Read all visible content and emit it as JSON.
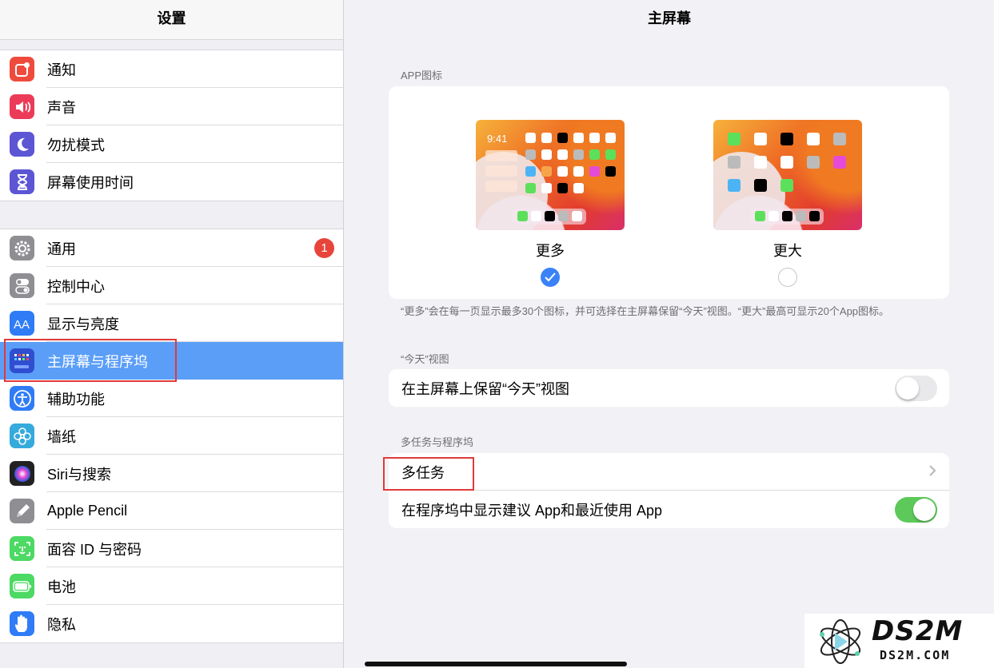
{
  "sidebar": {
    "title": "设置",
    "group1": [
      {
        "label": "通知",
        "icon": "notification-icon",
        "color": "#ef4b3d"
      },
      {
        "label": "声音",
        "icon": "speaker-icon",
        "color": "#ec3b59"
      },
      {
        "label": "勿扰模式",
        "icon": "moon-icon",
        "color": "#5c56d4"
      },
      {
        "label": "屏幕使用时间",
        "icon": "hourglass-icon",
        "color": "#5c56d4"
      }
    ],
    "group2": [
      {
        "label": "通用",
        "icon": "gear-icon",
        "color": "#8e8e93",
        "badge": "1"
      },
      {
        "label": "控制中心",
        "icon": "switches-icon",
        "color": "#8e8e93"
      },
      {
        "label": "显示与亮度",
        "icon": "text-size-icon",
        "color": "#2f7cf6"
      },
      {
        "label": "主屏幕与程序坞",
        "icon": "home-screen-icon",
        "color": "#2f4ed0",
        "selected": true
      },
      {
        "label": "辅助功能",
        "icon": "accessibility-icon",
        "color": "#2f7cf6"
      },
      {
        "label": "墙纸",
        "icon": "flower-icon",
        "color": "#35aadc"
      },
      {
        "label": "Siri与搜索",
        "icon": "siri-icon",
        "color": "#222222"
      },
      {
        "label": "Apple Pencil",
        "icon": "pencil-icon",
        "color": "#8e8e93"
      },
      {
        "label": "面容 ID 与密码",
        "icon": "face-id-icon",
        "color": "#4cd964"
      },
      {
        "label": "电池",
        "icon": "battery-icon",
        "color": "#4cd964"
      },
      {
        "label": "隐私",
        "icon": "hand-icon",
        "color": "#2f7cf6"
      }
    ]
  },
  "main": {
    "title": "主屏幕",
    "app_icons": {
      "header": "APP图标",
      "option_more": {
        "label": "更多",
        "time": "9:41",
        "selected": true
      },
      "option_bigger": {
        "label": "更大",
        "selected": false
      },
      "footnote": "“更多”会在每一页显示最多30个图标，并可选择在主屏幕保留“今天”视图。“更大”最高可显示20个App图标。"
    },
    "today": {
      "header": "“今天”视图",
      "keep_label": "在主屏幕上保留“今天”视图",
      "keep_on": false
    },
    "multitask": {
      "header": "多任务与程序坞",
      "multitask_label": "多任务",
      "suggest_label": "在程序坞中显示建议 App和最近使用 App",
      "suggest_on": true
    }
  },
  "watermark": {
    "text_big": "DS2M",
    "text_small": "DS2M.COM"
  },
  "colors": {
    "selected_row": "#5a9ef8",
    "toggle_on": "#5dc95a",
    "radio_on": "#3a82f7",
    "badge": "#e7453c",
    "highlight_box": "#e03a3a"
  }
}
